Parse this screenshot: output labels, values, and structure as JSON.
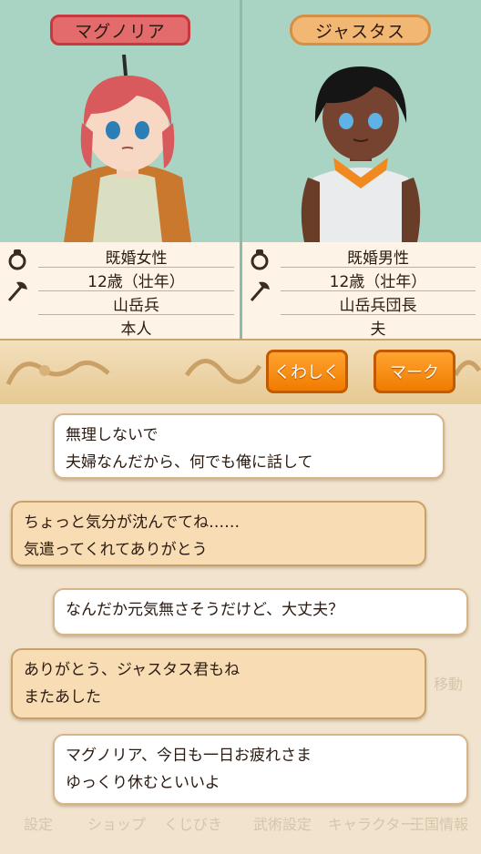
{
  "left": {
    "name": "マグノリア",
    "rows": [
      "既婚女性",
      "12歳（壮年）",
      "山岳兵",
      "本人"
    ]
  },
  "right": {
    "name": "ジャスタス",
    "rows": [
      "既婚男性",
      "12歳（壮年）",
      "山岳兵団長",
      "夫"
    ]
  },
  "buttons": {
    "detail": "くわしく",
    "mark": "マーク"
  },
  "messages": [
    {
      "side": "right",
      "lines": [
        "無理しないで",
        "夫婦なんだから、何でも俺に話して"
      ]
    },
    {
      "side": "left",
      "lines": [
        "ちょっと気分が沈んでてね……",
        "気遣ってくれてありがとう"
      ]
    },
    {
      "side": "right",
      "lines": [
        "なんだか元気無さそうだけど、大丈夫？"
      ]
    },
    {
      "side": "left",
      "lines": [
        "ありがとう、ジャスタス君もね",
        "またあした"
      ]
    },
    {
      "side": "right",
      "lines": [
        "マグノリア、今日も一日お疲れさま",
        "ゆっくり休むといいよ"
      ]
    }
  ],
  "background_menu": [
    "設定",
    "ショップ",
    "くじびき",
    "武術設定",
    "キャラクター",
    "王国情報",
    "移動"
  ],
  "colors": {
    "accent_orange": "#f07c00",
    "name_female": "#e46b6c",
    "name_male": "#f2b873",
    "top_bg": "#a9d4c4"
  }
}
